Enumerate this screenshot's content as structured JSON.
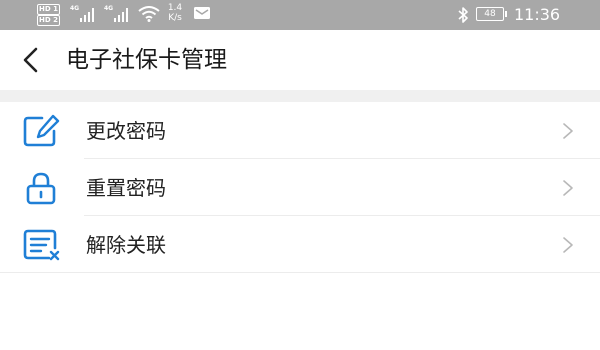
{
  "status_bar": {
    "sim1": "HD 1",
    "sim2": "HD 2",
    "network1": "4G",
    "network2": "4G",
    "speed_value": "1.4",
    "speed_unit": "K/s",
    "battery": "48",
    "time": "11:36"
  },
  "header": {
    "title": "电子社保卡管理"
  },
  "menu": [
    {
      "label": "更改密码",
      "icon": "edit-password-icon"
    },
    {
      "label": "重置密码",
      "icon": "lock-icon"
    },
    {
      "label": "解除关联",
      "icon": "unlink-card-icon"
    }
  ],
  "colors": {
    "icon_blue": "#1f7fd6",
    "status_bar": "#a8a8a8",
    "chevron": "#b8b8b8"
  }
}
